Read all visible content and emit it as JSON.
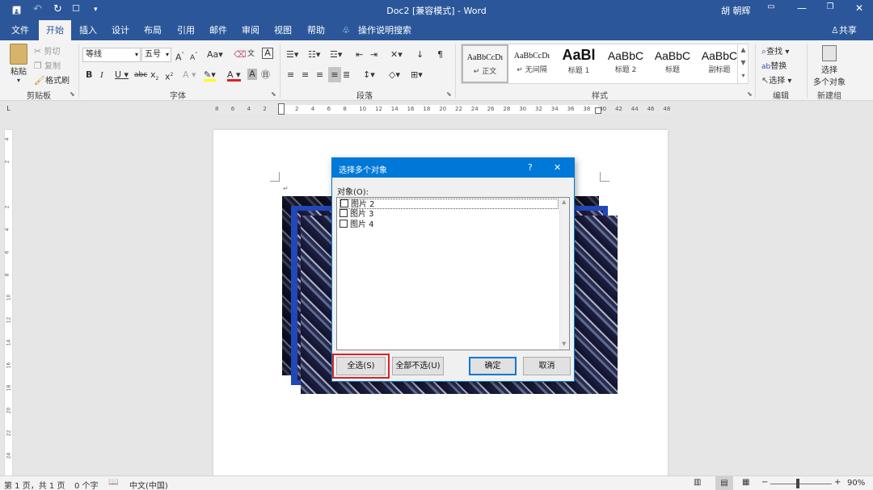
{
  "titlebar": {
    "title": "Doc2 [兼容模式] - Word",
    "user": "胡 朝辉",
    "save_icon": "save-icon",
    "undo_icon": "undo-icon",
    "redo_icon": "redo-icon",
    "touch_icon": "touch-mode-icon"
  },
  "tabs": [
    "文件",
    "开始",
    "插入",
    "设计",
    "布局",
    "引用",
    "邮件",
    "审阅",
    "视图",
    "帮助"
  ],
  "tellme": "操作说明搜索",
  "share": "共享",
  "clipboard": {
    "paste": "粘贴",
    "cut": "剪切",
    "copy": "复制",
    "format_painter": "格式刷",
    "label": "剪贴板"
  },
  "font": {
    "name": "等线",
    "size": "五号",
    "label": "字体",
    "aa": "Aa"
  },
  "paragraph": {
    "label": "段落"
  },
  "styles": {
    "label": "样式",
    "items": [
      {
        "preview": "AaBbCcDı",
        "name": "↵ 正文"
      },
      {
        "preview": "AaBbCcDı",
        "name": "↵ 无间隔"
      },
      {
        "preview": "AaBl",
        "name": "标题 1"
      },
      {
        "preview": "AaBbC",
        "name": "标题 2"
      },
      {
        "preview": "AaBbC",
        "name": "标题"
      },
      {
        "preview": "AaBbC",
        "name": "副标题"
      }
    ]
  },
  "editing": {
    "find": "查找",
    "replace": "替换",
    "select": "选择",
    "label": "编辑"
  },
  "newgroup": {
    "line1": "选择",
    "line2": "多个对象",
    "label": "新建组"
  },
  "ruler": {
    "h_ticks": [
      "8",
      "6",
      "4",
      "2",
      "",
      "2",
      "4",
      "6",
      "8",
      "10",
      "12",
      "14",
      "16",
      "18",
      "20",
      "22",
      "24",
      "26",
      "28",
      "30",
      "32",
      "34",
      "36",
      "38",
      "40",
      "42",
      "44",
      "46",
      "48"
    ],
    "v_ticks": [
      "4",
      "2",
      "",
      "2",
      "4",
      "6",
      "8",
      "10",
      "12",
      "14",
      "16",
      "18",
      "20",
      "22",
      "24"
    ],
    "corner": "L"
  },
  "dialog": {
    "title": "选择多个对象",
    "help": "?",
    "close": "✕",
    "list_label": "对象(O):",
    "items": [
      "图片 2",
      "图片 3",
      "图片 4"
    ],
    "select_all": "全选(S)",
    "unselect_all": "全部不选(U)",
    "ok": "确定",
    "cancel": "取消"
  },
  "status": {
    "page": "第 1 页，共 1 页",
    "words": "0 个字",
    "language": "中文(中国)",
    "zoom": "90%"
  },
  "colors": {
    "brand": "#2b579a",
    "dialog_accent": "#0078d7",
    "highlight_red": "#e02020"
  }
}
